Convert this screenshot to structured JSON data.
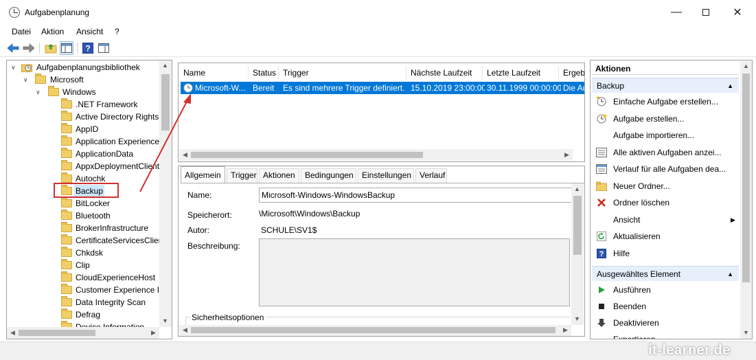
{
  "window": {
    "title": "Aufgabenplanung"
  },
  "menu": [
    "Datei",
    "Aktion",
    "Ansicht",
    "?"
  ],
  "tree": {
    "root": "Aufgabenplanungsbibliothek",
    "microsoft": "Microsoft",
    "windows": "Windows",
    "folders": [
      ".NET Framework",
      "Active Directory Rights",
      "AppID",
      "Application Experience",
      "ApplicationData",
      "AppxDeploymentClient",
      "Autochk",
      "Backup",
      "BitLocker",
      "Bluetooth",
      "BrokerInfrastructure",
      "CertificateServicesClien",
      "Chkdsk",
      "Clip",
      "CloudExperienceHost",
      "Customer Experience In",
      "Data Integrity Scan",
      "Defrag",
      "Device Information"
    ],
    "selected": "Backup"
  },
  "task_list": {
    "columns": [
      "Name",
      "Status",
      "Trigger",
      "Nächste Laufzeit",
      "Letzte Laufzeit",
      "Ergeb"
    ],
    "row": {
      "name": "Microsoft-W...",
      "status": "Bereit",
      "trigger": "Es sind mehrere Trigger definiert.",
      "next": "15.10.2019 23:00:00",
      "last": "30.11.1999 00:00:00",
      "result": "Die Au"
    }
  },
  "detail": {
    "tabs": [
      "Allgemein",
      "Trigger",
      "Aktionen",
      "Bedingungen",
      "Einstellungen",
      "Verlauf"
    ],
    "name_label": "Name:",
    "name_value": "Microsoft-Windows-WindowsBackup",
    "location_label": "Speicherort:",
    "location_value": "\\Microsoft\\Windows\\Backup",
    "author_label": "Autor:",
    "author_value": "SCHULE\\SV1$",
    "description_label": "Beschreibung:",
    "security_label": "Sicherheitsoptionen"
  },
  "actions": {
    "title": "Aktionen",
    "section1": "Backup",
    "items1": [
      {
        "label": "Einfache Aufgabe erstellen...",
        "icon": "basic-task-icon"
      },
      {
        "label": "Aufgabe erstellen...",
        "icon": "create-task-icon"
      },
      {
        "label": "Aufgabe importieren...",
        "icon": ""
      },
      {
        "label": "Alle aktiven Aufgaben anzei...",
        "icon": "active-tasks-icon"
      },
      {
        "label": "Verlauf für alle Aufgaben dea...",
        "icon": "history-icon"
      },
      {
        "label": "Neuer Ordner...",
        "icon": "new-folder-icon"
      },
      {
        "label": "Ordner löschen",
        "icon": "delete-icon"
      },
      {
        "label": "Ansicht",
        "icon": ""
      },
      {
        "label": "Aktualisieren",
        "icon": "refresh-icon"
      },
      {
        "label": "Hilfe",
        "icon": "help-icon"
      }
    ],
    "section2": "Ausgewähltes Element",
    "items2": [
      {
        "label": "Ausführen",
        "icon": "run-icon"
      },
      {
        "label": "Beenden",
        "icon": "stop-icon"
      },
      {
        "label": "Deaktivieren",
        "icon": "disable-icon"
      },
      {
        "label": "Exportieren...",
        "icon": ""
      }
    ]
  },
  "watermark": "it-learner.de",
  "colors": {
    "selection": "#0078d7",
    "annotation": "#d32f2f"
  }
}
